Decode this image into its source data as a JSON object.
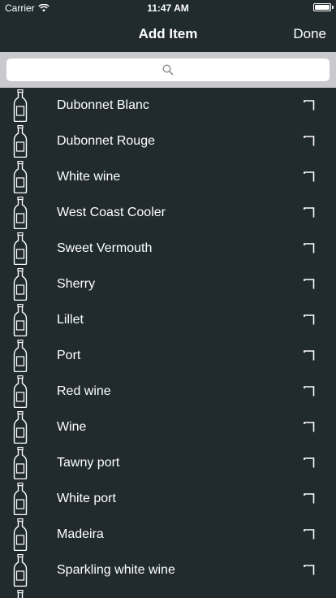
{
  "status_bar": {
    "carrier": "Carrier",
    "time": "11:47 AM"
  },
  "nav": {
    "title": "Add Item",
    "done_label": "Done"
  },
  "search": {
    "placeholder": "",
    "icon": "search-icon"
  },
  "items": [
    {
      "label": "Dubonnet Blanc"
    },
    {
      "label": "Dubonnet Rouge"
    },
    {
      "label": "White wine"
    },
    {
      "label": "West Coast Cooler"
    },
    {
      "label": "Sweet Vermouth"
    },
    {
      "label": "Sherry"
    },
    {
      "label": "Lillet"
    },
    {
      "label": "Port"
    },
    {
      "label": "Red wine"
    },
    {
      "label": "Wine"
    },
    {
      "label": "Tawny port"
    },
    {
      "label": "White port"
    },
    {
      "label": "Madeira"
    },
    {
      "label": "Sparkling white wine"
    }
  ],
  "colors": {
    "background": "#212b2e",
    "search_bar": "#c9c9ce",
    "text": "#ffffff"
  }
}
